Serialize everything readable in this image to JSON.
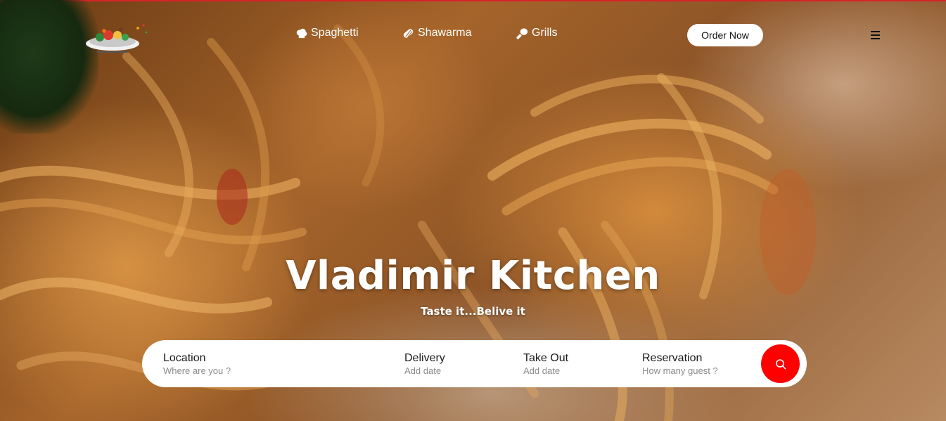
{
  "nav": {
    "items": [
      {
        "label": "Spaghetti",
        "icon": "cloud-food-icon"
      },
      {
        "label": "Shawarma",
        "icon": "bread-roll-icon"
      },
      {
        "label": "Grills",
        "icon": "drumstick-icon"
      }
    ],
    "order_label": "Order Now",
    "menu_icon": "hamburger-menu-icon"
  },
  "hero": {
    "title": "Vladimir Kitchen",
    "tagline": "Taste it...Belive it"
  },
  "search": {
    "location": {
      "label": "Location",
      "placeholder": "Where are you ?"
    },
    "delivery": {
      "label": "Delivery",
      "placeholder": "Add date"
    },
    "takeout": {
      "label": "Take Out",
      "placeholder": "Add date"
    },
    "reservation": {
      "label": "Reservation",
      "placeholder": "How many guest ?"
    },
    "button_icon": "search-icon"
  },
  "colors": {
    "accent": "#ff0000",
    "topline": "#d9222a",
    "text_light": "#ffffff"
  }
}
